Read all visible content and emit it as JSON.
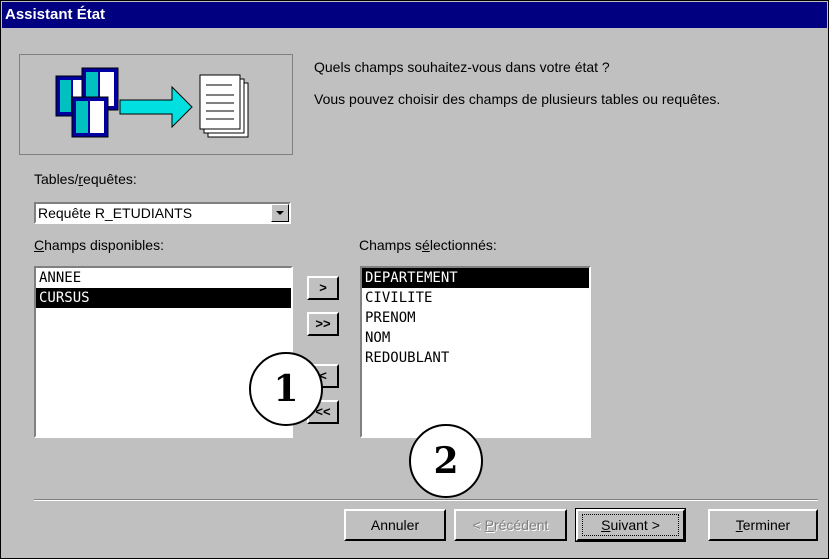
{
  "window": {
    "title": "Assistant État"
  },
  "intro": {
    "question": "Quels champs souhaitez-vous dans votre état ?",
    "hint": "Vous pouvez choisir des champs de plusieurs tables ou requêtes."
  },
  "tables": {
    "label_pre": "Tables/",
    "label_key": "r",
    "label_post": "equêtes:",
    "selected": "Requête R_ETUDIANTS"
  },
  "available": {
    "label_key": "C",
    "label_post": "hamps disponibles:",
    "items": [
      "ANNEE",
      "CURSUS"
    ]
  },
  "selected_fields": {
    "label_pre": "Champs s",
    "label_key": "é",
    "label_post": "lectionnés:",
    "items": [
      "DEPARTEMENT",
      "CIVILITE",
      "PRENOM",
      "NOM",
      "REDOUBLANT"
    ]
  },
  "move_buttons": {
    "add_one": ">",
    "add_all": ">>",
    "remove_one": "<",
    "remove_all": "<<"
  },
  "buttons": {
    "cancel": "Annuler",
    "previous_pre": "< ",
    "previous_key": "P",
    "previous_post": "récédent",
    "next_key": "S",
    "next_post": "uivant >",
    "finish_key": "T",
    "finish_post": "erminer"
  },
  "callouts": {
    "one": "1",
    "two": "2"
  }
}
